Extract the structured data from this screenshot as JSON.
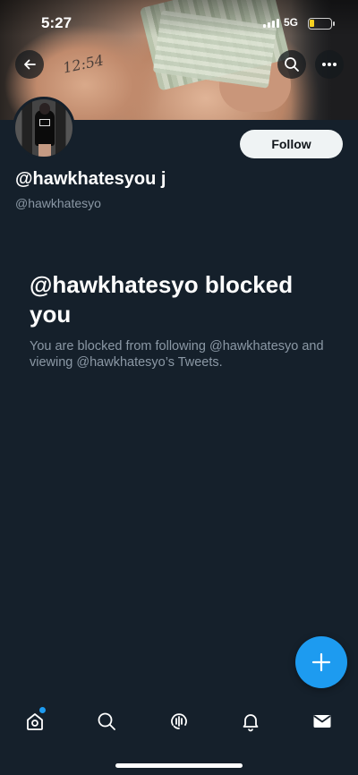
{
  "status_bar": {
    "time": "5:27",
    "network": "5G"
  },
  "banner": {
    "tattoo_text": "12:54",
    "back_icon": "arrow-left-icon",
    "search_icon": "search-icon",
    "more_icon": "more-horizontal-icon"
  },
  "profile": {
    "display_name": "@hawkhatesyou j",
    "handle": "@hawkhatesyo",
    "follow_label": "Follow"
  },
  "blocked": {
    "title": "@hawkhatesyo blocked you",
    "description": "You are blocked from following @hawkhatesyo and viewing @hawkhatesyo’s Tweets."
  },
  "fab": {
    "icon": "plus-icon"
  },
  "bottom_nav": {
    "items": [
      {
        "icon": "home-icon"
      },
      {
        "icon": "search-icon"
      },
      {
        "icon": "spaces-icon"
      },
      {
        "icon": "bell-icon"
      },
      {
        "icon": "mail-icon"
      }
    ]
  },
  "colors": {
    "background": "#15202b",
    "accent": "#1d9bf0",
    "secondary_text": "#8b98a5",
    "follow_button": "#eff3f4"
  }
}
